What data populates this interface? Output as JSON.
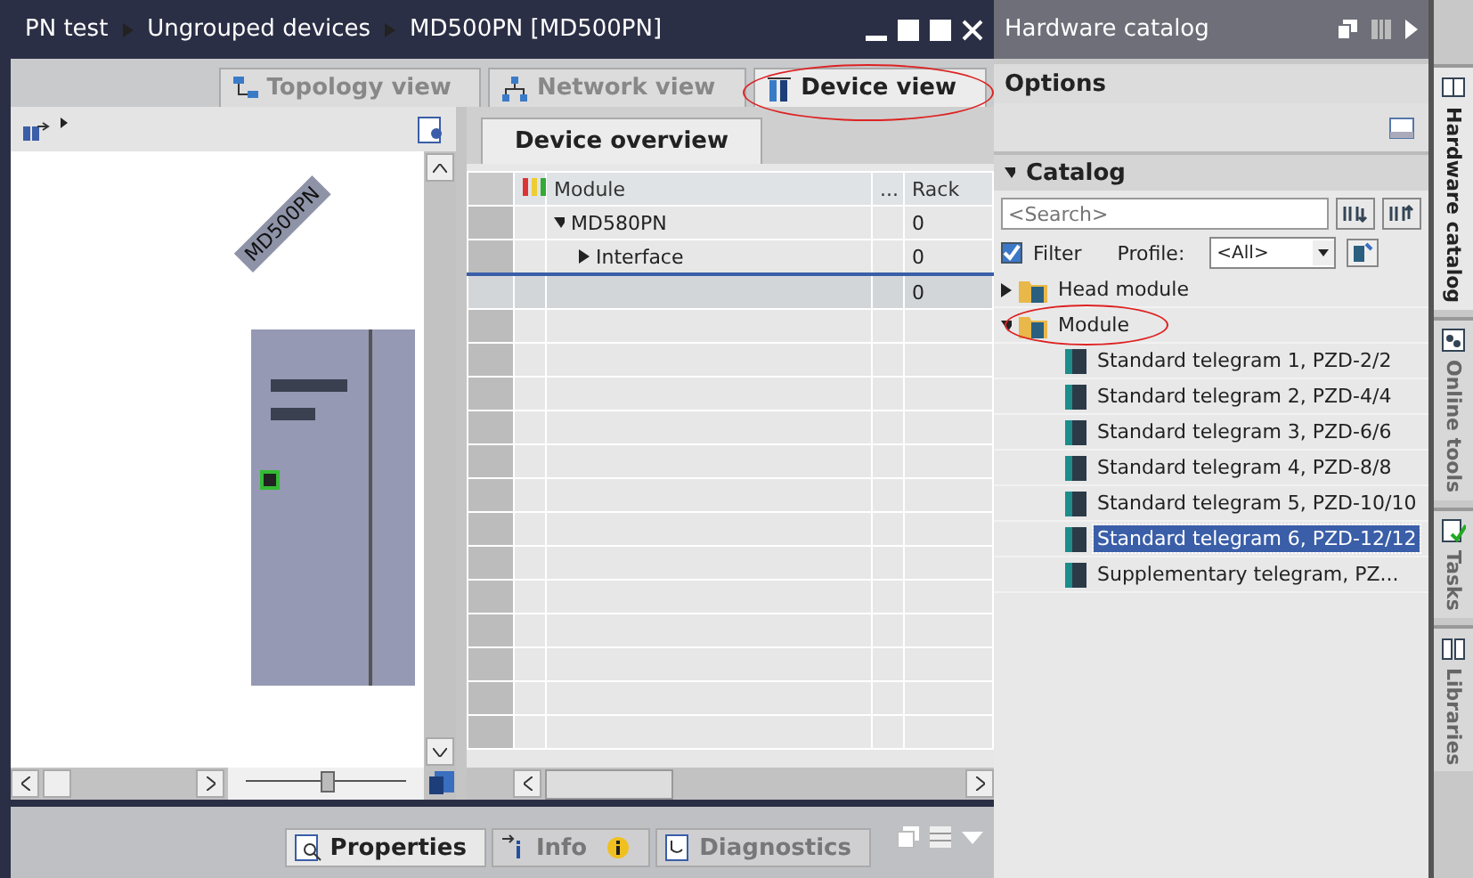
{
  "window": {
    "breadcrumb": [
      "PN test",
      "Ungrouped devices",
      "MD500PN [MD500PN]"
    ]
  },
  "view_tabs": [
    {
      "label": "Topology view",
      "kind": "topology",
      "selected": false
    },
    {
      "label": "Network view",
      "kind": "network",
      "selected": false
    },
    {
      "label": "Device view",
      "kind": "device",
      "selected": true
    }
  ],
  "canvas": {
    "device_label": "MD500PN",
    "zoom_slider": {
      "level": 0.5
    }
  },
  "overview": {
    "tab": "Device overview",
    "columns": [
      "Module",
      "...",
      "Rack"
    ],
    "rows": [
      {
        "module": "MD580PN",
        "rack": "0",
        "expanded": true,
        "selected": false,
        "children": [
          {
            "module": "Interface",
            "rack": "0",
            "expanded": false,
            "selected": false
          }
        ]
      },
      {
        "rack": "0",
        "selected": true
      }
    ]
  },
  "bottom_tabs": [
    {
      "label": "Properties",
      "kind": "properties",
      "selected": true
    },
    {
      "label": "Info",
      "kind": "info",
      "selected": false
    },
    {
      "label": "Diagnostics",
      "kind": "diagnostics",
      "selected": false
    }
  ],
  "catalog_panel": {
    "title": "Hardware catalog",
    "options": "Options",
    "catalog": "Catalog",
    "catalog_expanded": true,
    "search": {
      "placeholder": "<Search>"
    },
    "filter": {
      "label": "Filter",
      "checked": true
    },
    "profile": {
      "label": "Profile:",
      "value": "<All>"
    },
    "tree": [
      {
        "label": "Head module",
        "kind": "folder",
        "expanded": false,
        "selected": false
      },
      {
        "label": "Module",
        "kind": "folder",
        "expanded": true,
        "selected": false,
        "children": [
          {
            "label": "Standard telegram 1, PZD-2/2",
            "kind": "module",
            "selected": false
          },
          {
            "label": "Standard telegram 2, PZD-4/4",
            "kind": "module",
            "selected": false
          },
          {
            "label": "Standard telegram 3, PZD-6/6",
            "kind": "module",
            "selected": false
          },
          {
            "label": "Standard telegram 4, PZD-8/8",
            "kind": "module",
            "selected": false
          },
          {
            "label": "Standard telegram 5, PZD-10/10",
            "kind": "module",
            "selected": false
          },
          {
            "label": "Standard telegram 6, PZD-12/12",
            "kind": "module",
            "selected": true
          },
          {
            "label": "Supplementary telegram, PZ...",
            "kind": "module",
            "selected": false
          }
        ]
      }
    ]
  },
  "side_tabs": [
    {
      "label": "Hardware catalog",
      "kind": "catalog",
      "selected": true
    },
    {
      "label": "Online tools",
      "kind": "online",
      "selected": false
    },
    {
      "label": "Tasks",
      "kind": "tasks",
      "selected": false
    },
    {
      "label": "Libraries",
      "kind": "libraries",
      "selected": false
    }
  ]
}
